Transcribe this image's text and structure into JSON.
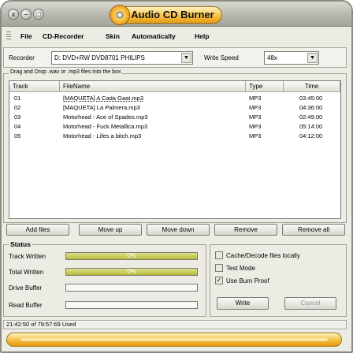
{
  "window": {
    "title": "Audio CD Burner",
    "close_glyph": "x",
    "minimize_glyph": "–",
    "maximize_glyph": "□"
  },
  "menu": [
    "File",
    "CD-Recorder",
    "Skin",
    "Automatically",
    "Help"
  ],
  "recorder": {
    "label": "Recorder",
    "device": "D: DVD+RW DVD8701 PHILIPS",
    "speed_label": "Write Speed",
    "speed": "48x"
  },
  "drag_caption": "Drag and Drop .wav or .mp3 files into the box",
  "tracklist": {
    "columns": [
      "Track",
      "FileName",
      "Type",
      "Time"
    ],
    "rows": [
      {
        "track": "01",
        "name": "[MAQUETA] A Cada Gaat.mp3",
        "type": "MP3",
        "time": "03:45:00"
      },
      {
        "track": "02",
        "name": "[MAQUETA] La Palmera.mp3",
        "type": "MP3",
        "time": "04:36:00"
      },
      {
        "track": "03",
        "name": "Motorhead - Ace of Spades.mp3",
        "type": "MP3",
        "time": "02:49:00"
      },
      {
        "track": "04",
        "name": "Motorhead - Fuck Metallica.mp3",
        "type": "MP3",
        "time": "05:14:00"
      },
      {
        "track": "05",
        "name": "Motorhead - Lifes a bitch.mp3",
        "type": "MP3",
        "time": "04:12:00"
      }
    ]
  },
  "buttons": {
    "add": "Add files",
    "up": "Move up",
    "down": "Move down",
    "remove": "Remove",
    "remove_all": "Remove all"
  },
  "status": {
    "title": "Status",
    "track_written": {
      "label": "Track Written",
      "percent": 0,
      "text": "0%"
    },
    "total_written": {
      "label": "Total Written",
      "percent": 0,
      "text": "0%"
    },
    "drive_buffer": {
      "label": "Drive Buffer",
      "percent": 0
    },
    "read_buffer": {
      "label": "Read Buffer",
      "percent": 0
    }
  },
  "options": {
    "cache": {
      "label": "Cache/Decode files locally",
      "checked": false
    },
    "test": {
      "label": "Test Mode",
      "checked": false
    },
    "burnproof": {
      "label": "Use Burn Proof",
      "checked": true
    },
    "write_button": "Write",
    "cancel_button": "Cancel"
  },
  "statusbar": "21:42:50 of 79:57:69 Used",
  "colors": {
    "accent": "#f4c040",
    "progress": "#c8c84a",
    "chrome": "#ecece4"
  }
}
